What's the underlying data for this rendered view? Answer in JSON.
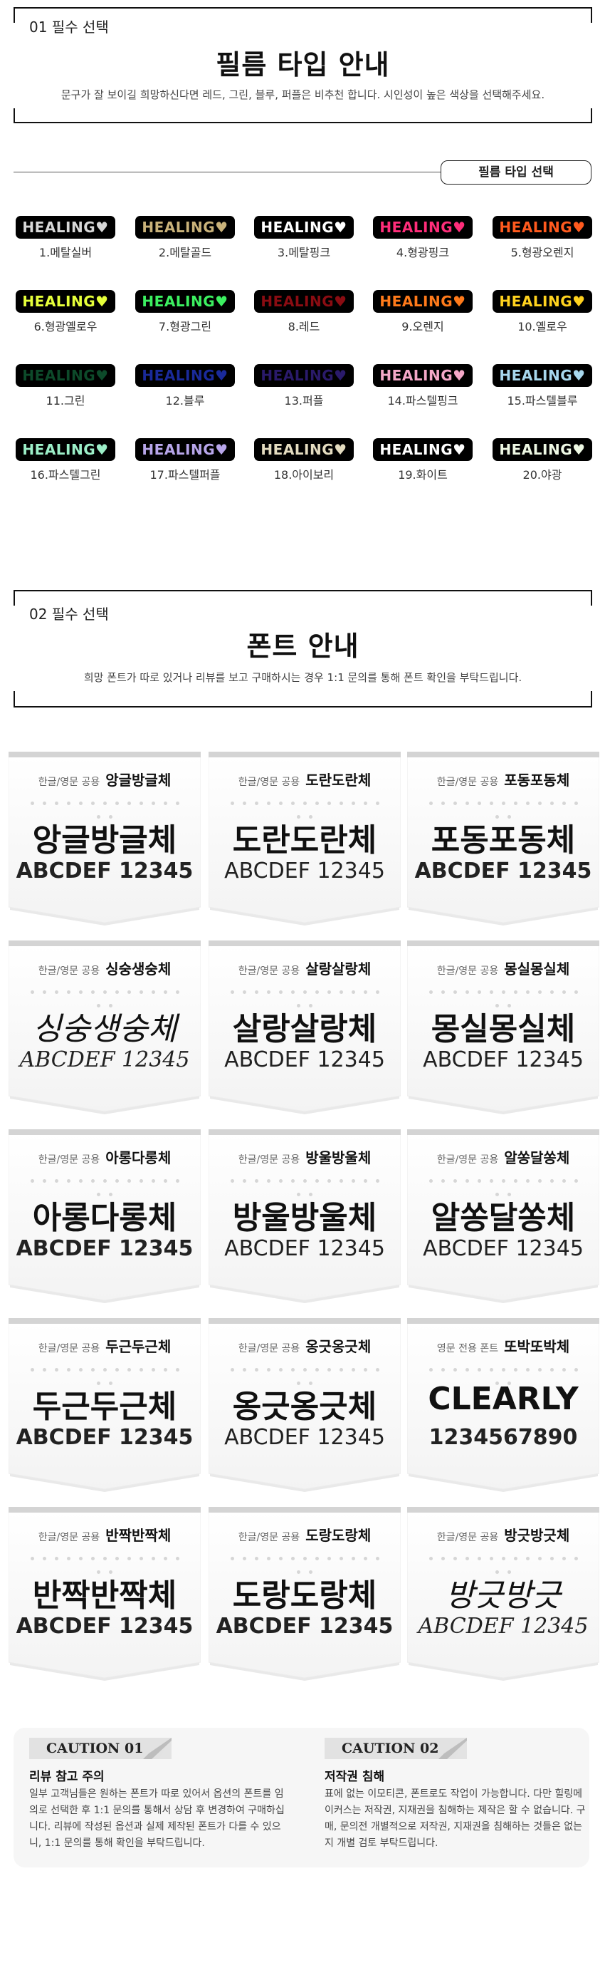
{
  "section1": {
    "label": "01 필수 선택",
    "title": "필름 타입 안내",
    "desc": "문구가 잘 보이길 희망하신다면 레드, 그린, 블루, 퍼플은 비추천 합니다. 시인성이 높은 색상을 선택해주세요.",
    "divider_label": "필름 타입 선택"
  },
  "films": [
    {
      "text": "HEALING♥",
      "name": "1.메탈실버",
      "color": "#d8d8d8"
    },
    {
      "text": "HEALING♥",
      "name": "2.메탈골드",
      "color": "#c9b27a"
    },
    {
      "text": "HEALING♥",
      "name": "3.메탈핑크",
      "color": "#ffffff"
    },
    {
      "text": "HEALING♥",
      "name": "4.형광핑크",
      "color": "#ff2d7a"
    },
    {
      "text": "HEALING♥",
      "name": "5.형광오렌지",
      "color": "#ff5a1e"
    },
    {
      "text": "HEALING♥",
      "name": "6.형광옐로우",
      "color": "#e6ff3a"
    },
    {
      "text": "HEALING♥",
      "name": "7.형광그린",
      "color": "#3cf060"
    },
    {
      "text": "HEALING♥",
      "name": "8.레드",
      "color": "#8a0c12"
    },
    {
      "text": "HEALING♥",
      "name": "9.오렌지",
      "color": "#ff7a1a"
    },
    {
      "text": "HEALING♥",
      "name": "10.옐로우",
      "color": "#ffd21e"
    },
    {
      "text": "HEALING♥",
      "name": "11.그린",
      "color": "#0d4a2a"
    },
    {
      "text": "HEALING♥",
      "name": "12.블루",
      "color": "#1a2a9a"
    },
    {
      "text": "HEALING♥",
      "name": "13.퍼플",
      "color": "#2a1a6a"
    },
    {
      "text": "HEALING♥",
      "name": "14.파스텔핑크",
      "color": "#f5a8c8"
    },
    {
      "text": "HEALING♥",
      "name": "15.파스텔블루",
      "color": "#a8d8ee"
    },
    {
      "text": "HEALING♥",
      "name": "16.파스텔그린",
      "color": "#9cefc8"
    },
    {
      "text": "HEALING♥",
      "name": "17.파스텔퍼플",
      "color": "#b8a6ea"
    },
    {
      "text": "HEALING♥",
      "name": "18.아이보리",
      "color": "#e4dcc0"
    },
    {
      "text": "HEALING♥",
      "name": "19.화이트",
      "color": "#ffffff"
    },
    {
      "text": "HEALING♥",
      "name": "20.야광",
      "color": "#eef8e4"
    }
  ],
  "section2": {
    "label": "02 필수 선택",
    "title": "폰트 안내",
    "desc": "희망 폰트가 따로 있거나 리뷰를 보고 구매하시는 경우 1:1 문의를 통해 폰트 확인을 부탁드립니다."
  },
  "fonts": [
    {
      "tag": "한글/영문 공용",
      "name": "앙글방글체",
      "sample": "앙글방글체",
      "sample2": "ABCDEF 12345",
      "style": "bold"
    },
    {
      "tag": "한글/영문 공용",
      "name": "도란도란체",
      "sample": "도란도란체",
      "sample2": "ABCDEF 12345",
      "style": "normal"
    },
    {
      "tag": "한글/영문 공용",
      "name": "포동포동체",
      "sample": "포동포동체",
      "sample2": "ABCDEF 12345",
      "style": "bold"
    },
    {
      "tag": "한글/영문 공용",
      "name": "싱숭생숭체",
      "sample": "싱숭생숭체",
      "sample2": "ABCDEF 12345",
      "style": "hand"
    },
    {
      "tag": "한글/영문 공용",
      "name": "살랑살랑체",
      "sample": "살랑살랑체",
      "sample2": "ABCDEF 12345",
      "style": "normal"
    },
    {
      "tag": "한글/영문 공용",
      "name": "몽실몽실체",
      "sample": "몽실몽실체",
      "sample2": "ABCDEF 12345",
      "style": "normal"
    },
    {
      "tag": "한글/영문 공용",
      "name": "아롱다롱체",
      "sample": "아롱다롱체",
      "sample2": "ABCDEF 12345",
      "style": "bold"
    },
    {
      "tag": "한글/영문 공용",
      "name": "방울방울체",
      "sample": "방울방울체",
      "sample2": "ABCDEF 12345",
      "style": "normal"
    },
    {
      "tag": "한글/영문 공용",
      "name": "알쏭달쏭체",
      "sample": "알쏭달쏭체",
      "sample2": "ABCDEF 12345",
      "style": "normal"
    },
    {
      "tag": "한글/영문 공용",
      "name": "두근두근체",
      "sample": "두근두근체",
      "sample2": "ABCDEF 12345",
      "style": "bold"
    },
    {
      "tag": "한글/영문 공용",
      "name": "옹긋옹긋체",
      "sample": "옹긋옹긋체",
      "sample2": "ABCDEF 12345",
      "style": "normal"
    },
    {
      "tag": "영문 전용 폰트",
      "name": "또박또박체",
      "sample": "CLEARLY",
      "sample2": "1234567890",
      "style": "bold"
    },
    {
      "tag": "한글/영문 공용",
      "name": "반짝반짝체",
      "sample": "반짝반짝체",
      "sample2": "ABCDEF 12345",
      "style": "bold"
    },
    {
      "tag": "한글/영문 공용",
      "name": "도랑도랑체",
      "sample": "도랑도랑체",
      "sample2": "ABCDEF 12345",
      "style": "bold"
    },
    {
      "tag": "한글/영문 공용",
      "name": "방긋방긋체",
      "sample": "방긋방긋",
      "sample2": "ABCDEF 12345",
      "style": "hand"
    }
  ],
  "caution": [
    {
      "tag": "CAUTION 01",
      "title": "리뷰 참고 주의",
      "body": "일부 고객님들은 원하는 폰트가 따로 있어서 옵션의 폰트를 임의로 선택한 후 1:1 문의를 통해서 상담 후 변경하여 구매하십니다. 리뷰에 작성된 옵션과 실제 제작된 폰트가 다를 수 있으니, 1:1 문의를 통해 확인을 부탁드립니다."
    },
    {
      "tag": "CAUTION 02",
      "title": "저작권 침해",
      "body": "표에 없는 이모티콘, 폰트로도 작업이 가능합니다. 다만 힐링메이커스는 저작권, 지재권을 침해하는 제작은 할 수 없습니다. 구매, 문의전 개별적으로 저작권, 지재권을 침해하는 것들은 없는지 개별 검토 부탁드립니다."
    }
  ]
}
